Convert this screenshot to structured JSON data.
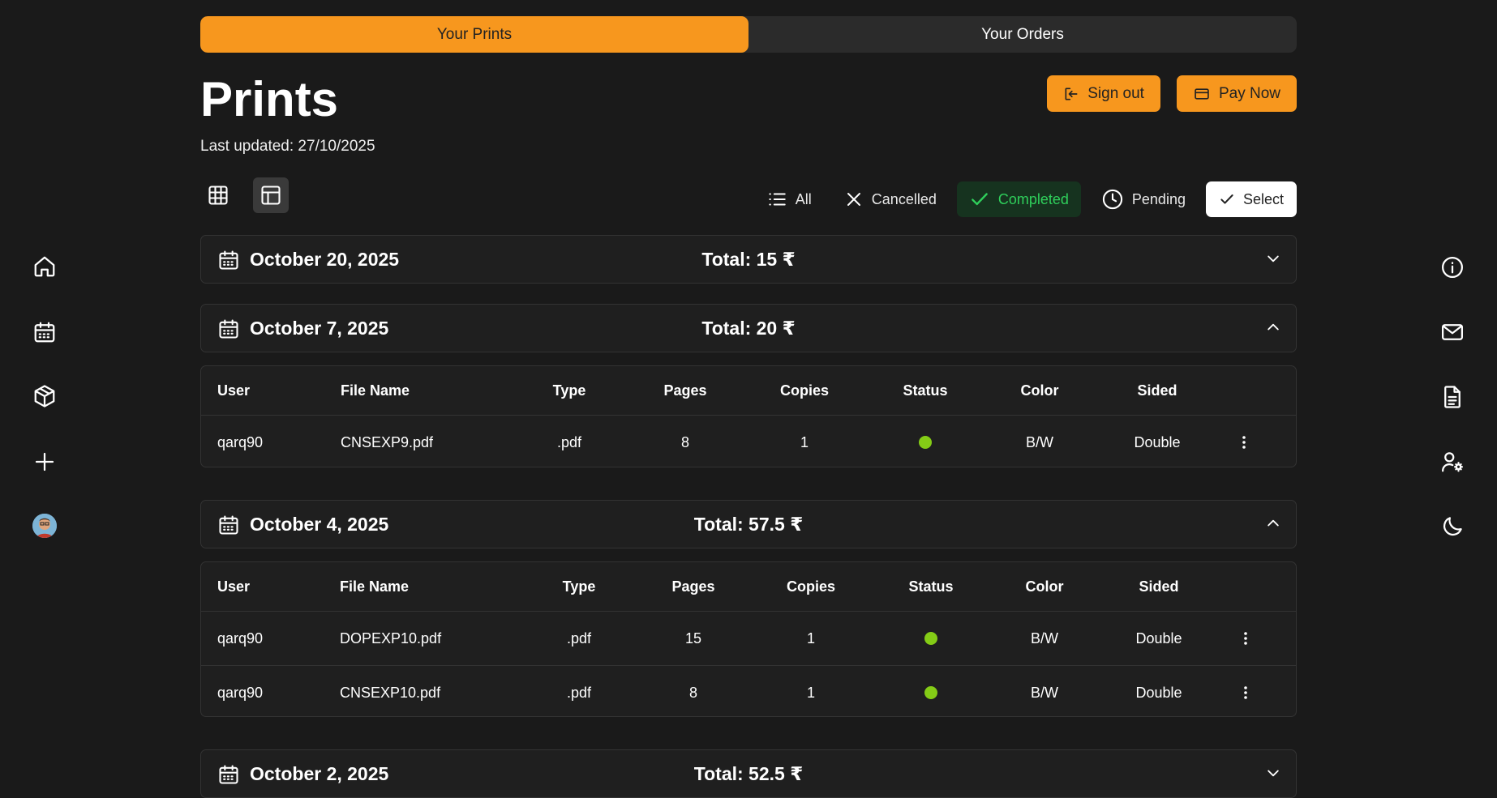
{
  "tabs": {
    "prints": "Your Prints",
    "orders": "Your Orders"
  },
  "page": {
    "title": "Prints",
    "last_updated": "Last updated: 27/10/2025"
  },
  "actions": {
    "sign_out": "Sign out",
    "pay_now": "Pay Now"
  },
  "filters": {
    "all": "All",
    "cancelled": "Cancelled",
    "completed": "Completed",
    "pending": "Pending",
    "select": "Select"
  },
  "colors": {
    "accent": "#f7971e",
    "status_completed": "#84cc16",
    "background": "#1a1a1a"
  },
  "left_nav": [
    "home-icon",
    "calendar-icon",
    "package-icon",
    "plus-icon",
    "avatar"
  ],
  "right_nav": [
    "info-icon",
    "mail-icon",
    "document-icon",
    "user-settings-icon",
    "moon-icon"
  ],
  "columns": [
    "User",
    "File Name",
    "Type",
    "Pages",
    "Copies",
    "Status",
    "Color",
    "Sided"
  ],
  "groups": [
    {
      "date": "October 20, 2025",
      "total": "Total: 15 ₹",
      "expanded": false,
      "rows": []
    },
    {
      "date": "October 7, 2025",
      "total": "Total: 20 ₹",
      "expanded": true,
      "rows": [
        {
          "user": "qarq90",
          "file": "CNSEXP9.pdf",
          "type": ".pdf",
          "pages": "8",
          "copies": "1",
          "status": "completed",
          "color": "B/W",
          "sided": "Double"
        }
      ]
    },
    {
      "date": "October 4, 2025",
      "total": "Total: 57.5 ₹",
      "expanded": true,
      "rows": [
        {
          "user": "qarq90",
          "file": "DOPEXP10.pdf",
          "type": ".pdf",
          "pages": "15",
          "copies": "1",
          "status": "completed",
          "color": "B/W",
          "sided": "Double"
        },
        {
          "user": "qarq90",
          "file": "CNSEXP10.pdf",
          "type": ".pdf",
          "pages": "8",
          "copies": "1",
          "status": "completed",
          "color": "B/W",
          "sided": "Double"
        }
      ]
    },
    {
      "date": "October 2, 2025",
      "total": "Total: 52.5 ₹",
      "expanded": false,
      "rows": []
    }
  ]
}
